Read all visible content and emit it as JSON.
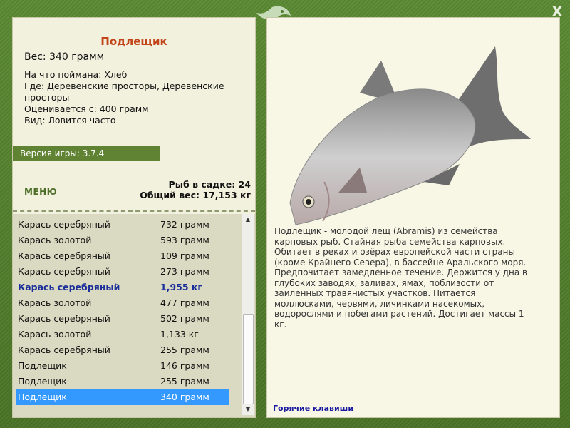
{
  "window": {
    "close_label": "X"
  },
  "fish": {
    "title": "Подлещик",
    "weight": "Вес: 340 грамм",
    "bait": "На что поймана: Хлеб",
    "location": "Где: Деревенские просторы, Деревенские просторы",
    "value": "Оценивается с: 400 грамм",
    "type": "Вид: Ловится часто"
  },
  "version": "Версия игры: 3.7.4",
  "menu_label": "МЕНЮ",
  "stats": {
    "count": "Рыб в садке: 24",
    "total": "Общий вес: 17,153 кг"
  },
  "catch_list": [
    {
      "name": "Карась серебряный",
      "weight": "732 грамм"
    },
    {
      "name": "Карась золотой",
      "weight": "593 грамм"
    },
    {
      "name": "Карась серебряный",
      "weight": "109 грамм"
    },
    {
      "name": "Карась серебряный",
      "weight": "273 грамм"
    },
    {
      "name": "Карась серебряный",
      "weight": "1,955 кг"
    },
    {
      "name": "Карась золотой",
      "weight": "477 грамм"
    },
    {
      "name": "Карась серебряный",
      "weight": "502 грамм"
    },
    {
      "name": "Карась золотой",
      "weight": "1,133 кг"
    },
    {
      "name": "Карась серебряный",
      "weight": "255 грамм"
    },
    {
      "name": "Подлещик",
      "weight": "146 грамм"
    },
    {
      "name": "Подлещик",
      "weight": "255 грамм"
    },
    {
      "name": "Подлещик",
      "weight": "340 грамм"
    }
  ],
  "description": "Подлещик - молодой лещ (Abramis) из семейства карповых рыб. Стайная рыба семейства карповых. Обитает в реках и озёрах европейской части страны (кроме Крайнего Севера), в бассейне Аральского моря. Предпочитает замедленное течение. Держится у дна в глубоких заводях, заливах, ямах, поблизости от заиленных травянистых участков. Питается моллюсками, червями, личинками насекомых, водорослями и побегами растений. Достигает массы 1 кг.",
  "hotkeys_label": "Горячие клавиши",
  "colors": {
    "frame": "#4e7a2a",
    "title": "#c3461b",
    "highlight_row": "#3399ff",
    "bold_row": "#1b2f9a"
  }
}
